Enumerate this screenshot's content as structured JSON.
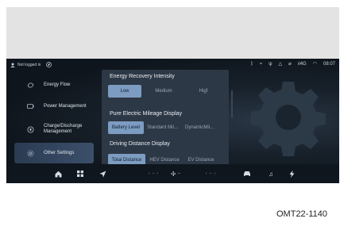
{
  "status_bar": {
    "login_text": "Not logged in",
    "network": "4G",
    "time": "08:07"
  },
  "sidebar": {
    "items": [
      {
        "label": "Energy Flow",
        "icon": "energy-flow-icon"
      },
      {
        "label": "Power Management",
        "icon": "battery-icon"
      },
      {
        "label": "Charge/Discharge Management",
        "icon": "charge-plug-icon"
      },
      {
        "label": "Other Settings",
        "icon": "gear-icon",
        "active": true
      }
    ]
  },
  "settings": {
    "energy_recovery": {
      "title": "Energy Recovery Intensity",
      "options": [
        "Low",
        "Medium",
        "Higf"
      ],
      "selected": "Low"
    },
    "pure_electric_mileage": {
      "title": "Pure Electric Mileage Display",
      "options": [
        "Battery Level",
        "Standard Mil...",
        "DynamicMil..."
      ],
      "selected": "Battery Level"
    },
    "driving_distance": {
      "title": "Driving Distance Display",
      "options": [
        "Total Distance",
        "HEV Distance",
        "EV Distance"
      ],
      "selected": "Total Distance"
    }
  },
  "dock": {
    "items": [
      "home-icon",
      "apps-grid-icon",
      "navigation-arrow-icon",
      "left-temp-control",
      "fan-icon",
      "right-temp-control",
      "car-icon",
      "music-icon",
      "lightning-icon"
    ],
    "left_temp": "--",
    "right_temp": "--",
    "fan_level": "--"
  },
  "caption": "OMT22-1140",
  "colors": {
    "screen_bg": "#10161f",
    "panel_bg": "#2d3846",
    "selected_option": "#7d9cc1",
    "active_sidebar": "#3c4f6a"
  }
}
